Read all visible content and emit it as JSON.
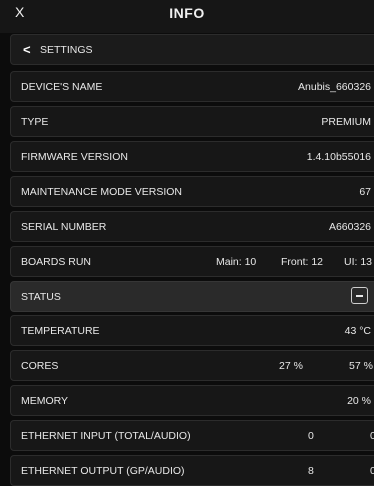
{
  "header": {
    "close_label": "X",
    "title": "INFO"
  },
  "nav": {
    "back_chevron": "<",
    "back_label": "SETTINGS"
  },
  "rows": {
    "device_name": {
      "label": "DEVICE'S NAME",
      "value": "Anubis_660326"
    },
    "type": {
      "label": "TYPE",
      "value": "PREMIUM"
    },
    "firmware": {
      "label": "FIRMWARE VERSION",
      "value": "1.4.10b55016"
    },
    "maintenance": {
      "label": "MAINTENANCE MODE VERSION",
      "value": "67"
    },
    "serial": {
      "label": "SERIAL NUMBER",
      "value": "A660326"
    },
    "boards_run": {
      "label": "BOARDS RUN",
      "main": "Main: 10",
      "front": "Front: 12",
      "ui": "UI: 13"
    }
  },
  "status": {
    "label": "STATUS",
    "collapse_icon": "minus-icon",
    "temperature": {
      "label": "TEMPERATURE",
      "value": "43 °C"
    },
    "cores": {
      "label": "CORES",
      "core1": "27 %",
      "core2": "57 %"
    },
    "memory": {
      "label": "MEMORY",
      "value": "20 %"
    },
    "ethernet_input": {
      "label": "ETHERNET INPUT (TOTAL/AUDIO)",
      "total": "0",
      "audio": "0"
    },
    "ethernet_output": {
      "label": "ETHERNET OUTPUT (GP/AUDIO)",
      "gp": "8",
      "audio": "0"
    }
  }
}
